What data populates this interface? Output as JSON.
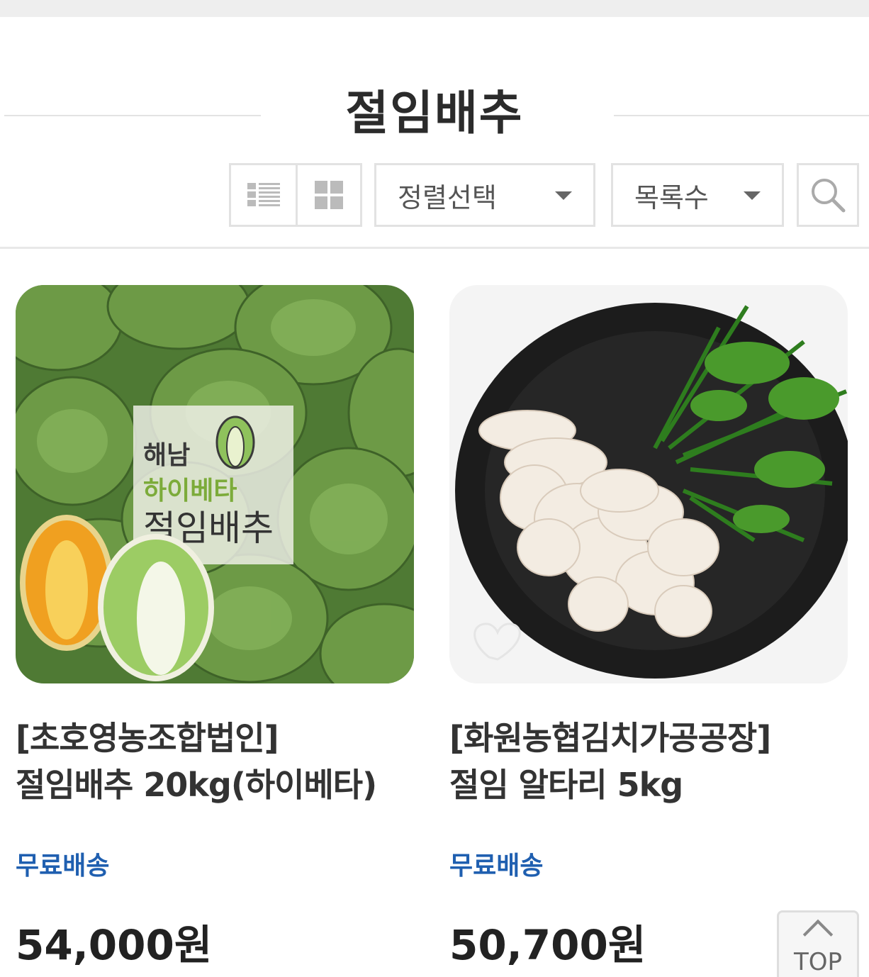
{
  "header": {
    "title": "절임배추"
  },
  "toolbar": {
    "sort_label": "정렬선택",
    "count_label": "목록수"
  },
  "products": [
    {
      "name_line1": "[초호영농조합법인]",
      "name_line2": "절임배추 20kg(하이베타)",
      "shipping": "무료배송",
      "price": "54,000원",
      "image_text": {
        "line1": "해남",
        "line2": "하이베타",
        "line3": "절임배추"
      }
    },
    {
      "name_line1": "[화원농협김치가공공장]",
      "name_line2": "절임 알타리 5kg",
      "shipping": "무료배송",
      "price": "50,700원"
    }
  ],
  "top_button": {
    "label": "TOP"
  },
  "colors": {
    "shipping": "#1f5fb0",
    "border": "#e2e2e2",
    "text": "#333333"
  },
  "icons": [
    "list-view-icon",
    "grid-view-icon",
    "caret-down-icon",
    "search-icon",
    "heart-icon",
    "chevron-up-icon"
  ]
}
